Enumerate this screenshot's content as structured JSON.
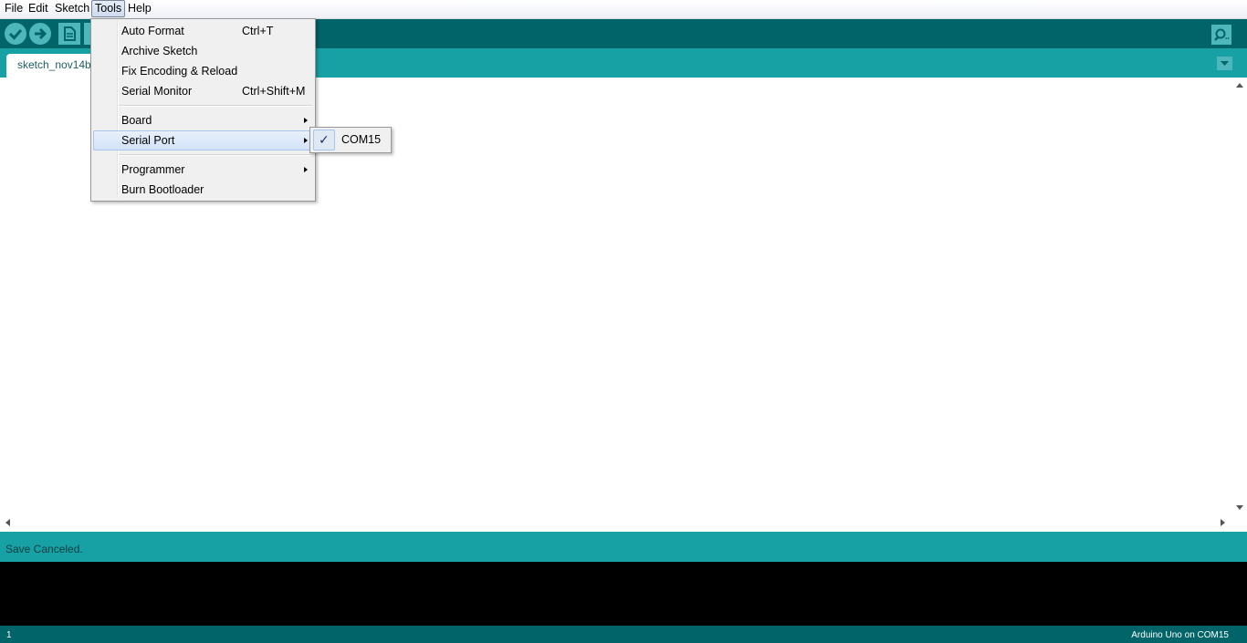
{
  "menubar": {
    "items": [
      {
        "label": "File"
      },
      {
        "label": "Edit"
      },
      {
        "label": "Sketch"
      },
      {
        "label": "Tools"
      },
      {
        "label": "Help"
      }
    ],
    "active": "Tools"
  },
  "toolbar": {
    "verify_icon": "checkmark-icon",
    "upload_icon": "arrow-right-icon",
    "new_icon": "document-icon",
    "serial_monitor_icon": "magnifier-icon"
  },
  "tabs": [
    {
      "label": "sketch_nov14b"
    }
  ],
  "tools_menu": {
    "items": [
      {
        "label": "Auto Format",
        "shortcut": "Ctrl+T"
      },
      {
        "label": "Archive Sketch",
        "shortcut": ""
      },
      {
        "label": "Fix Encoding & Reload",
        "shortcut": ""
      },
      {
        "label": "Serial Monitor",
        "shortcut": "Ctrl+Shift+M"
      },
      {
        "label": "Board",
        "submenu": true
      },
      {
        "label": "Serial Port",
        "submenu": true,
        "highlighted": true
      },
      {
        "label": "Programmer",
        "submenu": true
      },
      {
        "label": "Burn Bootloader",
        "shortcut": ""
      }
    ]
  },
  "serial_port_submenu": {
    "items": [
      {
        "label": "COM15",
        "checked": true,
        "check_mark": "✓"
      }
    ]
  },
  "status": {
    "message": "Save Canceled."
  },
  "footer": {
    "line_number": "1",
    "board_info": "Arduino Uno on COM15"
  },
  "colors": {
    "toolbar": "#006468",
    "tabstrip": "#17a1a5",
    "button": "#4db7bb",
    "console": "#000000"
  }
}
